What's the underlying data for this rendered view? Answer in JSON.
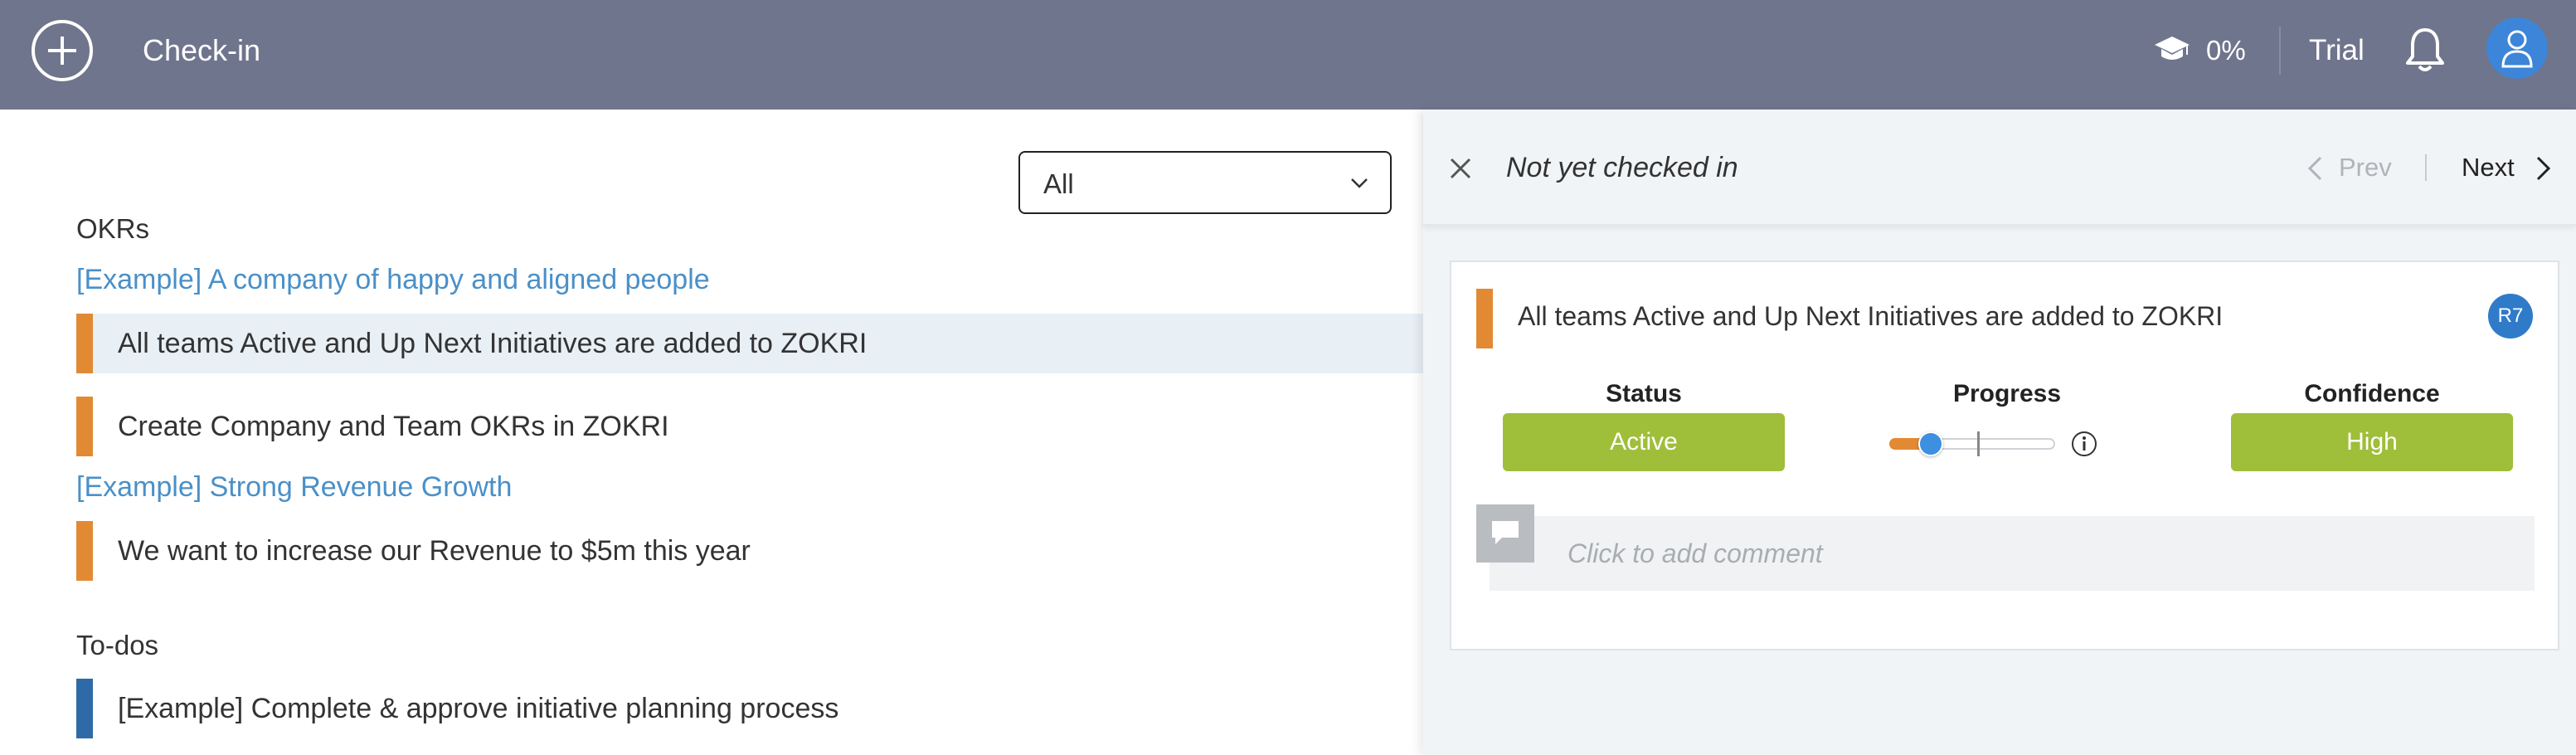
{
  "header": {
    "title": "Check-in",
    "progress_percent": "0%",
    "trial_label": "Trial"
  },
  "left": {
    "filter_value": "All",
    "okrs_heading": "OKRs",
    "groups": [
      {
        "title": "[Example] A company of happy and aligned people",
        "items": [
          "All teams Active and Up Next Initiatives are added to ZOKRI",
          "Create Company and Team OKRs in ZOKRI"
        ]
      },
      {
        "title": "[Example] Strong Revenue Growth",
        "items": [
          "We want to increase our Revenue to $5m this year"
        ]
      }
    ],
    "todos_heading": "To-dos",
    "todos": [
      "[Example] Complete & approve initiative planning process"
    ]
  },
  "panel": {
    "title": "Not yet checked in",
    "prev_label": "Prev",
    "next_label": "Next",
    "card": {
      "title": "All teams Active and Up Next Initiatives are added to ZOKRI",
      "owner_initials": "R7",
      "status_label": "Status",
      "status_value": "Active",
      "progress_label": "Progress",
      "progress_fraction": 0.25,
      "confidence_label": "Confidence",
      "confidence_value": "High",
      "comment_placeholder": "Click to add comment"
    }
  },
  "colors": {
    "header_bg": "#6f758c",
    "link": "#4a90c8",
    "okr_bar": "#e28a33",
    "todo_bar": "#2f6aa8",
    "pill_green": "#9fbe3a",
    "accent_blue": "#3d85d8"
  }
}
